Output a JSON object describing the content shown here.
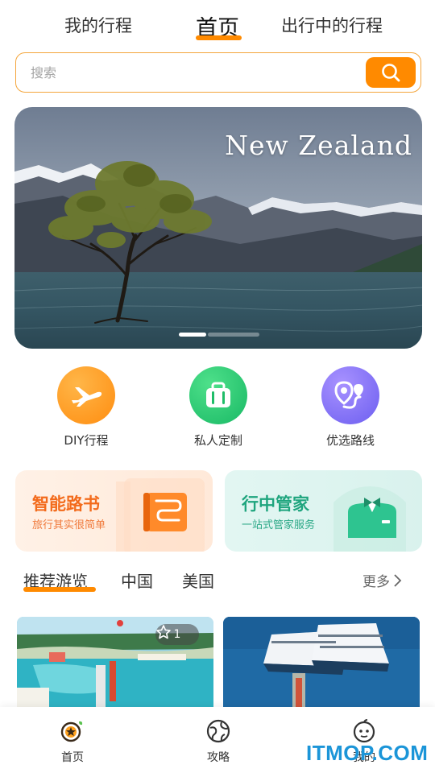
{
  "top_tabs": {
    "items": [
      {
        "label": "我的行程"
      },
      {
        "label": "首页"
      },
      {
        "label": "出行中的行程"
      }
    ],
    "active": "首页",
    "accent": "#ff8a00"
  },
  "search": {
    "placeholder": "搜索",
    "button_icon": "search-icon"
  },
  "banner": {
    "caption": "New Zealand",
    "slide_indicator": {
      "current": 1
    }
  },
  "quick_entries": [
    {
      "label": "DIY行程",
      "icon": "airplane-icon",
      "color": "#ff9a1f"
    },
    {
      "label": "私人定制",
      "icon": "suitcase-icon",
      "color": "#22c26f"
    },
    {
      "label": "优选路线",
      "icon": "route-pin-icon",
      "color": "#7d6bf5"
    }
  ],
  "feature_cards": [
    {
      "title": "智能路书",
      "subtitle": "旅行其实很简单",
      "icon": "guidebook-icon",
      "color": "#f36b1c"
    },
    {
      "title": "行中管家",
      "subtitle": "一站式管家服务",
      "icon": "butler-icon",
      "color": "#1fa57e"
    }
  ],
  "section_tabs": {
    "items": [
      {
        "label": "推荐游览"
      },
      {
        "label": "中国"
      },
      {
        "label": "美国"
      }
    ],
    "active": "推荐游览",
    "more_label": "更多"
  },
  "photos": [
    {
      "icon": "tropical-island-photo",
      "favorite_count": "1"
    },
    {
      "icon": "cruise-ship-photo"
    }
  ],
  "bottom_nav": {
    "items": [
      {
        "label": "首页",
        "icon": "home-wheel-icon"
      },
      {
        "label": "攻略",
        "icon": "globe-icon"
      },
      {
        "label": "我的",
        "icon": "profile-face-icon"
      }
    ],
    "active": "首页"
  },
  "watermark": "ITMOP.COM"
}
